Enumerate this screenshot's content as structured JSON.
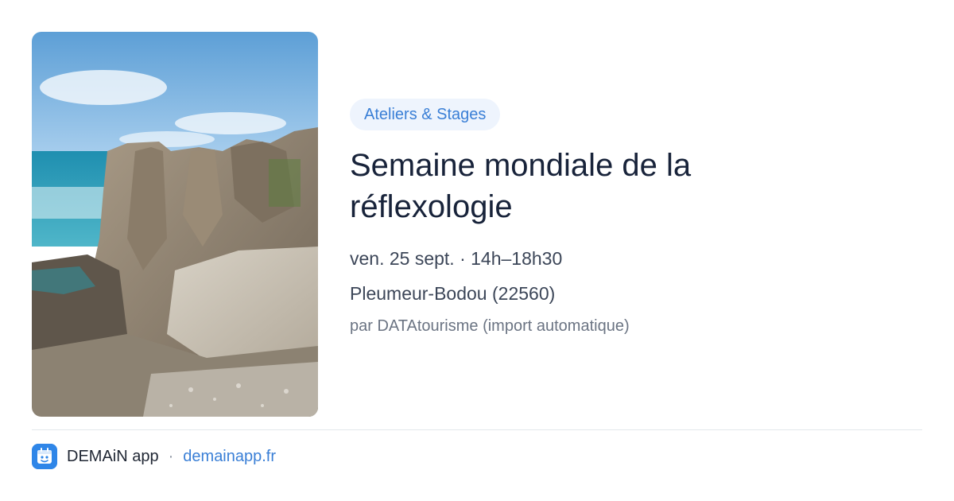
{
  "event": {
    "category": "Ateliers & Stages",
    "title": "Semaine mondiale de la réflexologie",
    "datetime": "ven. 25 sept. · 14h–18h30",
    "location": "Pleumeur-Bodou (22560)",
    "source": "par DATAtourisme (import automatique)"
  },
  "footer": {
    "app_name": "DEMAiN app",
    "separator": "·",
    "site": "demainapp.fr"
  },
  "icons": {
    "photo": "coastal-rocks-photo",
    "app": "demain-app-icon"
  },
  "colors": {
    "accent": "#3a7fd6",
    "tag_background": "#eef4fd",
    "title": "#18233a"
  }
}
